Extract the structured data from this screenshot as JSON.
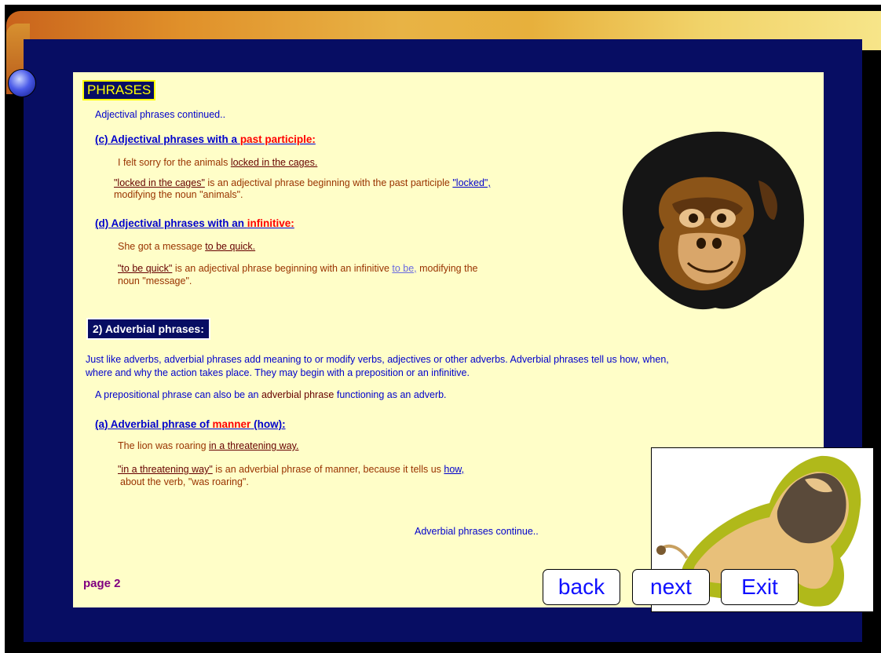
{
  "title": "PHRASES",
  "intro": "Adjectival phrases continued..",
  "sec_c": {
    "heading_a": "(c) Adjectival phrases with a ",
    "heading_b": "past participle:",
    "ex_a": "I felt sorry for the animals ",
    "ex_b": "locked in the cages.",
    "exp_a": "\"locked in the cages\"",
    "exp_b": " is an adjectival phrase beginning with the past participle ",
    "exp_c": "\"locked\",",
    "exp_line2": "modifying the noun \"animals\"."
  },
  "sec_d": {
    "heading_a": "(d) Adjectival phrases with an ",
    "heading_b": "infinitive:",
    "ex_a": "She got a message ",
    "ex_b": "to be quick.",
    "exp_a": "\"to be quick\"",
    "exp_b": " is an adjectival phrase beginning with an infinitive ",
    "exp_c": "to be,",
    "exp_d": " modifying the",
    "exp_line2": "noun \"message\"."
  },
  "section2": "2) Adverbial phrases:",
  "adv_intro_1": "Just like adverbs, adverbial phrases add meaning to or modify verbs, adjectives or other adverbs. Adverbial phrases tell us how, when,",
  "adv_intro_2": "where and why the action takes place. They may begin with a preposition or an infinitive.",
  "prep_a": "A prepositional phrase can also be an ",
  "prep_b": "adverbial phrase",
  "prep_c": " functioning as an adverb.",
  "sec_a2": {
    "heading_a": "(a) Adverbial phrase of ",
    "heading_b": "manner",
    "heading_c": " (how):",
    "ex_a": "The lion was roaring ",
    "ex_b": "in a threatening way.",
    "exp_a": "\"in a threatening way\"",
    "exp_b": " is an adverbial phrase of manner, because it tells us ",
    "exp_c": "how,",
    "exp_line2": "about the verb, \"was roaring\"."
  },
  "continue": "Adverbial phrases continue..",
  "page_label": "page 2",
  "buttons": {
    "back": "back",
    "next": "next",
    "exit": "Exit"
  },
  "colors": {
    "navy": "#070d63",
    "cream": "#fffec8",
    "accent_red": "#ff0000",
    "link_blue": "#0000cc"
  },
  "icons": [
    "chimpanzee-illustration",
    "lion-illustration",
    "blue-knob"
  ]
}
